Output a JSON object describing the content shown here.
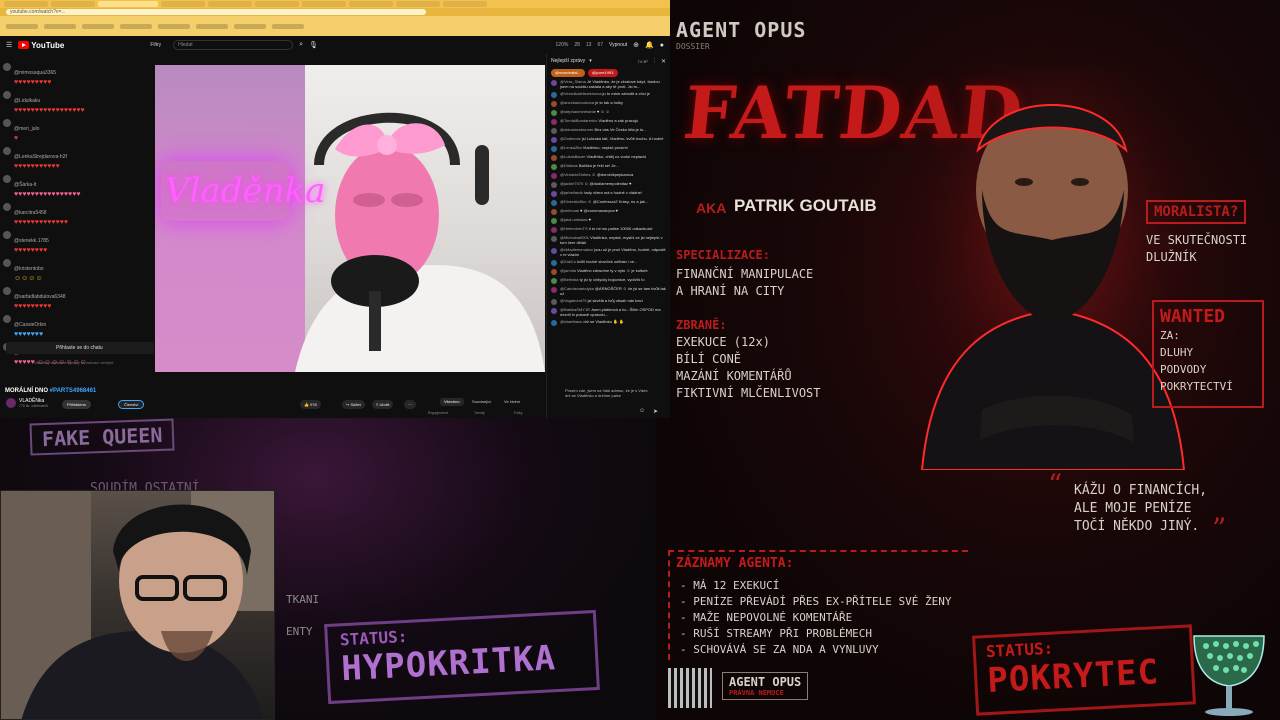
{
  "browser": {
    "url": "youtube.com/watch?v=...",
    "tabs_count": 10
  },
  "youtube": {
    "brand": "YouTube",
    "filters_label": "Filtry",
    "search_placeholder": "Hledat",
    "stats": [
      "120%",
      "28",
      "13",
      "67"
    ],
    "vypnout": "Vypnout"
  },
  "left_chat": {
    "users": [
      {
        "name": "@mimosaqua3365",
        "msg": "♥♥♥♥♥♥♥♥♥",
        "color": "#e53935"
      },
      {
        "name": "@Lidulkaku",
        "msg": "♥♥♥♥♥♥♥♥♥♥♥♥♥♥♥♥♥",
        "color": "#e53935"
      },
      {
        "name": "@meri_julo",
        "msg": "♥",
        "color": "#e53935"
      },
      {
        "name": "@LenkaStrejdarova-h2f",
        "msg": "♥♥♥♥♥♥♥♥♥♥♥",
        "color": "#e53935"
      },
      {
        "name": "@Šárka-lt",
        "msg": "♥♥♥♥♥♥♥♥♥♥♥♥♥♥♥♥",
        "color": "#f06292"
      },
      {
        "name": "@karcitra5458",
        "msg": "♥♥♥♥♥♥♥♥♥♥♥♥♥",
        "color": "#e53935"
      },
      {
        "name": "@stenekk.1785",
        "msg": "♥♥♥♥♥♥♥♥",
        "color": "#e53935"
      },
      {
        "name": "@kristentobo",
        "msg": "☺☺☺☺",
        "color": "#fbc02d"
      },
      {
        "name": "@sarfadlabdulova6348",
        "msg": "♥♥♥♥♥♥♥♥♥",
        "color": "#e53935"
      },
      {
        "name": "@CassieOrkin",
        "msg": "♥♥♥♥♥♥♥",
        "color": "#42a5f5"
      },
      {
        "name": "@akribekmeschel147",
        "msg": "♥♥♥♥♥ ☺☺☺☺☺☺☺",
        "color": "#f06292"
      },
      {
        "name": "@MikealaOsolkova6",
        "msg": "Vladěnko nebreč, moc prosím, nestojí ti to za tohle",
        "color": "#dddddd"
      }
    ],
    "login_label": "Přihlaste se do chatu",
    "hidden_note": "Všechny odeslané zprávy se zobrazí veřejně."
  },
  "video": {
    "neon_text": "Vladěnka"
  },
  "right_chat": {
    "header": "Nejlepší zprávy",
    "viewers": "74 3P",
    "pins": [
      "@marcinatal...",
      "@jcore1993"
    ],
    "messages": [
      {
        "name": "@Vera_Slama",
        "text": "Jé Vladěnko, že je zkratové když, fandou jsem na sociálu zaslala a aby tě proti. Jsi to..."
      },
      {
        "name": "@Veronikaleliszteinova",
        "text": "ju to mám zahodit a chci je"
      },
      {
        "name": "@anezkanovakova",
        "text": "je to tak a holky"
      },
      {
        "name": "@stephanmeehanie",
        "text": "♥ ☺ ☺"
      },
      {
        "name": "@TomášBondarenko",
        "text": "Vladěno a zák pracuju"
      },
      {
        "name": "@oldoslavstrunner",
        "text": "Bez vás Ve Česko těla je to..."
      },
      {
        "name": "@Zartheniz",
        "text": "jsi Lukraka tati, Vladěno, kvůli trochu. A hodně"
      },
      {
        "name": "@LenkaZita",
        "text": "Vladěnko, neplač prosím!"
      },
      {
        "name": "@LukasBauer",
        "text": "Vladěnko, chtěj co vodní neplacíš"
      },
      {
        "name": "@Dirkbas",
        "text": "Balíčka je řekl se! Je..."
      },
      {
        "name": "@VendulaTarbes",
        "text": "☺ @dominikpepkarova"
      },
      {
        "name": "@jackle7970",
        "text": "☺ @dudlamempolimitaz ♥"
      },
      {
        "name": "@jarbellarvik",
        "text": "tady včera má s hodně z vládne!"
      },
      {
        "name": "@DiverzitaSko",
        "text": "☺ @ConfessorZ Krásy, no a jak..."
      },
      {
        "name": "@zelmoak",
        "text": "♥ @connmacavyna ♥"
      },
      {
        "name": "@jaloLumbalac",
        "text": "♥"
      },
      {
        "name": "@HebenhenTS",
        "text": "ti to mi mu patise 10000 odkazbuzki"
      },
      {
        "name": "@Michalna0001",
        "text": "Vladěnka, neplač, myslíš ze jsi nejlepší v tom čem děláš"
      },
      {
        "name": "@vMadleenmakov",
        "text": "jsou už je proč Vladěno, hodně, odpustit v ní vlastní"
      },
      {
        "name": "@ZakCo",
        "text": "kvůli hodně slovíček udělalo i ve..."
      },
      {
        "name": "@jarmila",
        "text": "Vladěno zdravíme ty v nýto ☺ je kultuře"
      },
      {
        "name": "@Berlinka",
        "text": "ty jsi ty vždycky bojovnice, vydržíš to"
      },
      {
        "name": "@Cairolsmarkdyka",
        "text": "@ARNOŠČER ☺ že jsi se tam kvůli tak už"
      },
      {
        "name": "@Vagabond79",
        "text": "jsi skvělá a tvůj obsah nás baví"
      },
      {
        "name": "@BabikaSMYJR",
        "text": "Jsem platinová a hc...Šilim OSPOD ma nezdíl in pokaně opravdu..."
      },
      {
        "name": "@lolaetbauc",
        "text": "drž se Vladěnko ✋ ✋"
      }
    ],
    "input_hint": "Prosím zde, jsem na Vaši adresu, že je s Vámi, drž se Vladěnko a držíme palce",
    "input_placeholder": "Napište zprávu..."
  },
  "meta": {
    "title_prefix": "MORÁLNÍ DNO",
    "title_tag": "#PARTS4968461",
    "channel": "VLADĚNka",
    "subs": "775 tis. odběratelů",
    "subscribe": "Přihlášeno",
    "join": "Členství",
    "likes": "978",
    "share": "Sdílet",
    "save": "Uložit",
    "tabs": [
      "Všechno",
      "Související",
      "Ve živém"
    ],
    "sub_labels": [
      "Engagement",
      "Trendy",
      "Fotky"
    ]
  },
  "poster_right": {
    "agent": "AGENT OPUS",
    "agent_sub": "DOSSIER",
    "name": "FATDAD",
    "aka": "AKA",
    "aka_name": "PATRIK GOUTAIB",
    "spec_head": "SPECIALIZACE:",
    "spec": [
      "FINANČNÍ MANIPULACE",
      "A HRANÍ NA CITY"
    ],
    "zbrane_head": "ZBRANĚ:",
    "zbrane": [
      "EXEKUCE (12x)",
      "BÍLÍ CONĚ",
      "MAZÁNÍ KOMENTÁŘŮ",
      "FIKTIVNÍ MLČENLIVOST"
    ],
    "moralista": "MORALISTA?",
    "skutecnost": [
      "VE SKUTEČNOSTI",
      "DLUŽNÍK"
    ],
    "wanted": "WANTED",
    "wanted_list": [
      "ZA:",
      "DLUHY",
      "PODVODY",
      "POKRYTECTVÍ"
    ],
    "quote": [
      "KÁŽU O FINANCÍCH,",
      "ALE MOJE PENÍZE",
      "TOČÍ NĚKDO JINÝ."
    ],
    "zaznamy_head": "ZÁZNAMY AGENTA:",
    "zaznamy": [
      "- MÁ 12 EXEKUCÍ",
      "- PENÍZE PŘEVÁDÍ PŘES EX-PŘÍTELE SVÉ ŽENY",
      "- MAŽE NEPOVOLNÉ KOMENTÁŘE",
      "- RUŠÍ STREAMY PŘI PROBLÉMECH",
      "- SCHOVÁVÁ SE ZA NDA A VYNLUVY"
    ],
    "status_label": "STATUS:",
    "status_value": "POKRYTEC",
    "opus": "AGENT OPUS",
    "opus_sub": "PRÁVNA NEMOCE"
  },
  "poster_left": {
    "fake_queen": "FAKE QUEEN",
    "soudim": "SOUDÍM OSTATNÍ",
    "tkani": "TKANI",
    "enty": "ENTY",
    "status_label": "STATUS:",
    "status_value": "HYPOKRITKA"
  },
  "colors": {
    "accent_red": "#b81c1c",
    "yt_red": "#ff0000",
    "neon_pink": "#ff60ff",
    "hypo_purple": "#b070d0"
  }
}
